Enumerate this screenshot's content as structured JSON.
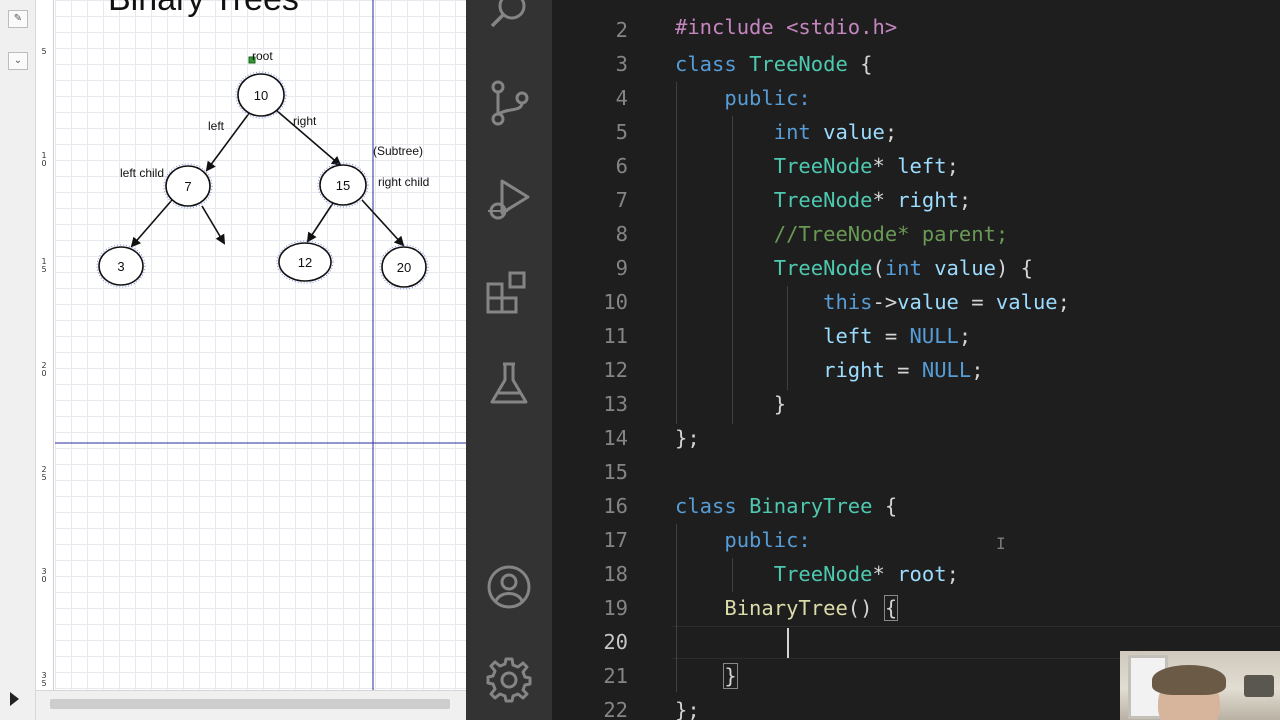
{
  "drawing": {
    "title": "Binary Trees",
    "ruler_ticks": [
      "5",
      "1\n0",
      "1\n5",
      "2\n0",
      "2\n5",
      "3\n0",
      "3\n5"
    ],
    "nodes": [
      {
        "id": "n10",
        "label": "10"
      },
      {
        "id": "n7",
        "label": "7"
      },
      {
        "id": "n15",
        "label": "15"
      },
      {
        "id": "n3",
        "label": "3"
      },
      {
        "id": "n12",
        "label": "12"
      },
      {
        "id": "n20",
        "label": "20"
      }
    ],
    "annotations": {
      "root": "root",
      "left": "left",
      "right": "right",
      "left_child": "left child",
      "right_child": "right child",
      "subtree": "(Subtree)"
    }
  },
  "activity_bar": {
    "icons": [
      "search-icon",
      "source-control-icon",
      "run-debug-icon",
      "extensions-icon",
      "testing-icon",
      "account-icon",
      "settings-gear-icon"
    ]
  },
  "editor": {
    "lines": [
      {
        "n": "2",
        "code": ""
      },
      {
        "n": "3",
        "code": "class TreeNode {"
      },
      {
        "n": "4",
        "code": "    public:"
      },
      {
        "n": "5",
        "code": "        int value;"
      },
      {
        "n": "6",
        "code": "        TreeNode* left;"
      },
      {
        "n": "7",
        "code": "        TreeNode* right;"
      },
      {
        "n": "8",
        "code": "        //TreeNode* parent;"
      },
      {
        "n": "9",
        "code": "        TreeNode(int value) {"
      },
      {
        "n": "10",
        "code": "            this->value = value;"
      },
      {
        "n": "11",
        "code": "            left = NULL;"
      },
      {
        "n": "12",
        "code": "            right = NULL;"
      },
      {
        "n": "13",
        "code": "        }"
      },
      {
        "n": "14",
        "code": "};"
      },
      {
        "n": "15",
        "code": ""
      },
      {
        "n": "16",
        "code": "class BinaryTree {"
      },
      {
        "n": "17",
        "code": "    public:"
      },
      {
        "n": "18",
        "code": "        TreeNode* root;"
      },
      {
        "n": "19",
        "code": "    BinaryTree() {"
      },
      {
        "n": "20",
        "code": "        "
      },
      {
        "n": "21",
        "code": "    }"
      },
      {
        "n": "22",
        "code": "};"
      }
    ],
    "top_partial": "#include <stdio.h>",
    "colors": {
      "background": "#1e1e1e",
      "keyword": "#569cd6",
      "type": "#4ec9b0",
      "comment": "#6a9955",
      "function": "#dcdcaa",
      "variable": "#9cdcfe"
    }
  }
}
